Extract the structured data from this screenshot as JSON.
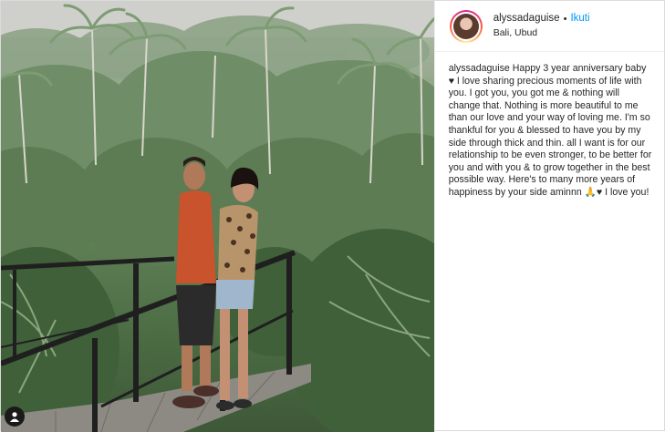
{
  "post": {
    "username": "alyssadaguise",
    "separator": "•",
    "follow_label": "Ikuti",
    "location": "Bali, Ubud",
    "caption_user": "alyssadaguise",
    "caption_text": "Happy 3 year anniversary baby ♥ I love sharing precious moments of life with you. I got you, you got me & nothing will change that. Nothing is more beautiful to me than our love and your way of loving me. I'm so thankful for you & blessed to have you by my side through thick and thin. all I want is for our relationship to be even stronger, to be better for you and with you & to grow together in the best possible way. Here's to many more years of happiness by your side aminnn 🙏♥ I love you!"
  },
  "icons": {
    "user_tag": "person-icon",
    "avatar": "profile-photo"
  },
  "colors": {
    "follow_blue": "#0095f6",
    "text": "#262626",
    "border": "#dbdbdb"
  }
}
